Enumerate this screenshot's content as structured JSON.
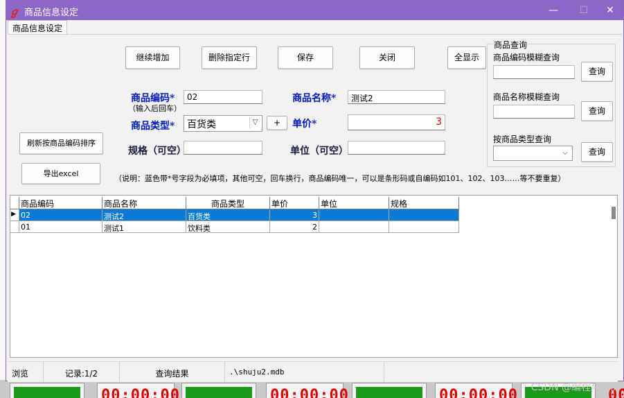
{
  "window": {
    "title": "商品信息设定",
    "tab": "商品信息设定"
  },
  "toolbar": {
    "continue_add": "继续增加",
    "delete_row": "删除指定行",
    "save": "保存",
    "close": "关闭",
    "show_all": "全显示",
    "refresh_sort": "刷新按商品编码排序",
    "export": "导出excel"
  },
  "form": {
    "code_label": "商品编码*",
    "code_hint": "（输入后回车）",
    "code_value": "02",
    "name_label": "商品名称*",
    "name_value": "测试2",
    "type_label": "商品类型*",
    "type_value": "百货类",
    "add_type_button": "+",
    "price_label": "单价*",
    "price_value": "3",
    "spec_label": "规格（可空）",
    "spec_value": "",
    "unit_label": "单位（可空）",
    "unit_value": "",
    "note": "（说明：蓝色带*号字段为必填项，其他可空，回车换行，商品编码唯一，可以是条形码或自编码如101、102、103……等不要重复）"
  },
  "search": {
    "group_title": "商品查询",
    "code_fuzzy_label": "商品编码模糊查询",
    "name_fuzzy_label": "商品名称模糊查询",
    "type_label": "按商品类型查询",
    "query_button": "查询"
  },
  "grid": {
    "columns": [
      "商品编码",
      "商品名称",
      "商品类型",
      "单价",
      "单位",
      "规格"
    ],
    "rows": [
      {
        "code": "02",
        "name": "测试2",
        "type": "百货类",
        "price": "3",
        "unit": "",
        "spec": ""
      },
      {
        "code": "01",
        "name": "测试1",
        "type": "饮料类",
        "price": "2",
        "unit": "",
        "spec": ""
      }
    ]
  },
  "status": {
    "mode": "浏览",
    "records": "记录:1/2",
    "query_result": "查询结果",
    "file": ".\\shuju2.mdb"
  },
  "background": {
    "timer_text": "00:00:00",
    "watermark": "CSDN @编程与实例"
  },
  "colors": {
    "titlebar": "#8c68c6",
    "required_label": "#0018c0",
    "selection": "#0a7ad6",
    "price_value": "#e00000"
  }
}
